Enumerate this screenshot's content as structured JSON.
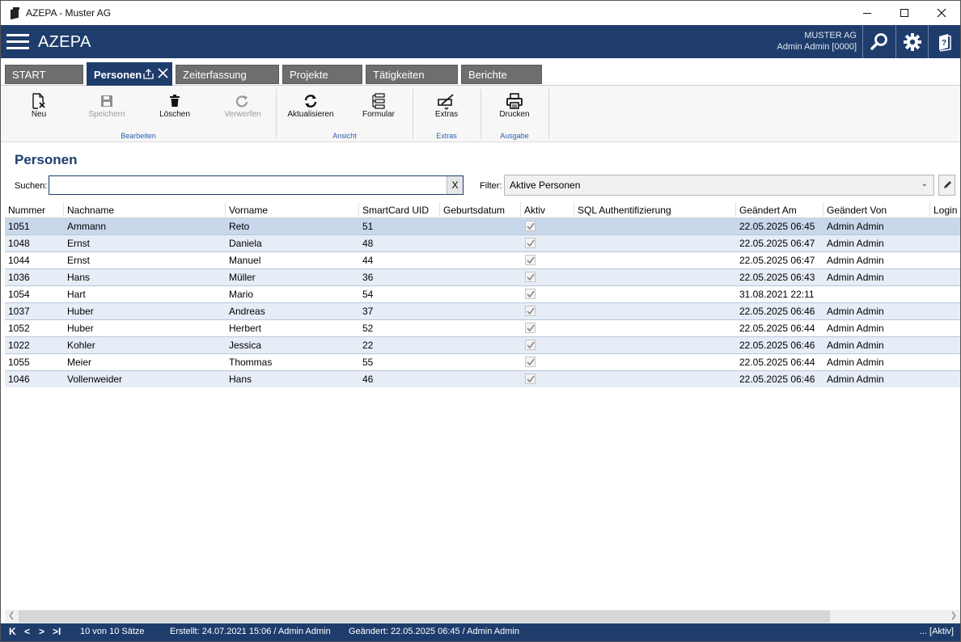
{
  "window": {
    "title": "AZEPA - Muster AG",
    "minimize": "–",
    "maximize": "☐",
    "close": "✕"
  },
  "header": {
    "brand": "AZEPA",
    "company": "MUSTER AG",
    "user": "Admin Admin [0000]"
  },
  "tabs": [
    {
      "label": "START"
    },
    {
      "label": "Personen"
    },
    {
      "label": "Zeiterfassung"
    },
    {
      "label": "Projekte"
    },
    {
      "label": "Tätigkeiten"
    },
    {
      "label": "Berichte"
    }
  ],
  "ribbon": {
    "buttons": {
      "neu": "Neu",
      "speichern": "Speichern",
      "loeschen": "Löschen",
      "verwerfen": "Verwerfen",
      "aktualisieren": "Aktualisieren",
      "formular": "Formular",
      "extras": "Extras",
      "drucken": "Drucken"
    },
    "groups": {
      "bearbeiten": "Bearbeiten",
      "ansicht": "Ansicht",
      "extras": "Extras",
      "ausgabe": "Ausgabe"
    }
  },
  "page": {
    "title": "Personen",
    "search_label": "Suchen:",
    "search_value": "",
    "search_clear": "X",
    "filter_label": "Filter:",
    "filter_value": "Aktive Personen"
  },
  "grid": {
    "columns": [
      "Nummer",
      "Nachname",
      "Vorname",
      "SmartCard UID",
      "Geburtsdatum",
      "Aktiv",
      "SQL Authentifizierung",
      "Geändert Am",
      "Geändert Von",
      "Login"
    ],
    "rows": [
      {
        "nummer": "1051",
        "nachname": "Ammann",
        "vorname": "Reto",
        "uid": "51",
        "geburtsdatum": "",
        "aktiv": true,
        "sql": "",
        "geaendert_am": "22.05.2025 06:45",
        "geaendert_von": "Admin Admin"
      },
      {
        "nummer": "1048",
        "nachname": "Ernst",
        "vorname": "Daniela",
        "uid": "48",
        "geburtsdatum": "",
        "aktiv": true,
        "sql": "",
        "geaendert_am": "22.05.2025 06:47",
        "geaendert_von": "Admin Admin"
      },
      {
        "nummer": "1044",
        "nachname": "Ernst",
        "vorname": "Manuel",
        "uid": "44",
        "geburtsdatum": "",
        "aktiv": true,
        "sql": "",
        "geaendert_am": "22.05.2025 06:47",
        "geaendert_von": "Admin Admin"
      },
      {
        "nummer": "1036",
        "nachname": "Hans",
        "vorname": "Müller",
        "uid": "36",
        "geburtsdatum": "",
        "aktiv": true,
        "sql": "",
        "geaendert_am": "22.05.2025 06:43",
        "geaendert_von": "Admin Admin"
      },
      {
        "nummer": "1054",
        "nachname": "Hart",
        "vorname": "Mario",
        "uid": "54",
        "geburtsdatum": "",
        "aktiv": true,
        "sql": "",
        "geaendert_am": "31.08.2021 22:11",
        "geaendert_von": ""
      },
      {
        "nummer": "1037",
        "nachname": "Huber",
        "vorname": "Andreas",
        "uid": "37",
        "geburtsdatum": "",
        "aktiv": true,
        "sql": "",
        "geaendert_am": "22.05.2025 06:46",
        "geaendert_von": "Admin Admin"
      },
      {
        "nummer": "1052",
        "nachname": "Huber",
        "vorname": "Herbert",
        "uid": "52",
        "geburtsdatum": "",
        "aktiv": true,
        "sql": "",
        "geaendert_am": "22.05.2025 06:44",
        "geaendert_von": "Admin Admin"
      },
      {
        "nummer": "1022",
        "nachname": "Kohler",
        "vorname": "Jessica",
        "uid": "22",
        "geburtsdatum": "",
        "aktiv": true,
        "sql": "",
        "geaendert_am": "22.05.2025 06:46",
        "geaendert_von": "Admin Admin"
      },
      {
        "nummer": "1055",
        "nachname": "Meier",
        "vorname": "Thommas",
        "uid": "55",
        "geburtsdatum": "",
        "aktiv": true,
        "sql": "",
        "geaendert_am": "22.05.2025 06:44",
        "geaendert_von": "Admin Admin"
      },
      {
        "nummer": "1046",
        "nachname": "Vollenweider",
        "vorname": "Hans",
        "uid": "46",
        "geburtsdatum": "",
        "aktiv": true,
        "sql": "",
        "geaendert_am": "22.05.2025 06:46",
        "geaendert_von": "Admin Admin"
      }
    ]
  },
  "statusbar": {
    "nav_first": "K",
    "nav_prev": "<",
    "nav_next": ">",
    "nav_last": ">I",
    "count": "10 von 10 Sätze",
    "created": "Erstellt: 24.07.2021 15:06 / Admin Admin",
    "changed": "Geändert: 22.05.2025 06:45 / Admin Admin",
    "state": "... [Aktiv]"
  },
  "colors": {
    "primary": "#1f3d6c",
    "tab_inactive": "#6e6e6e",
    "row_alt": "#e6edf7",
    "row_selected": "#c9d7eb",
    "group_label": "#2a5db0"
  }
}
